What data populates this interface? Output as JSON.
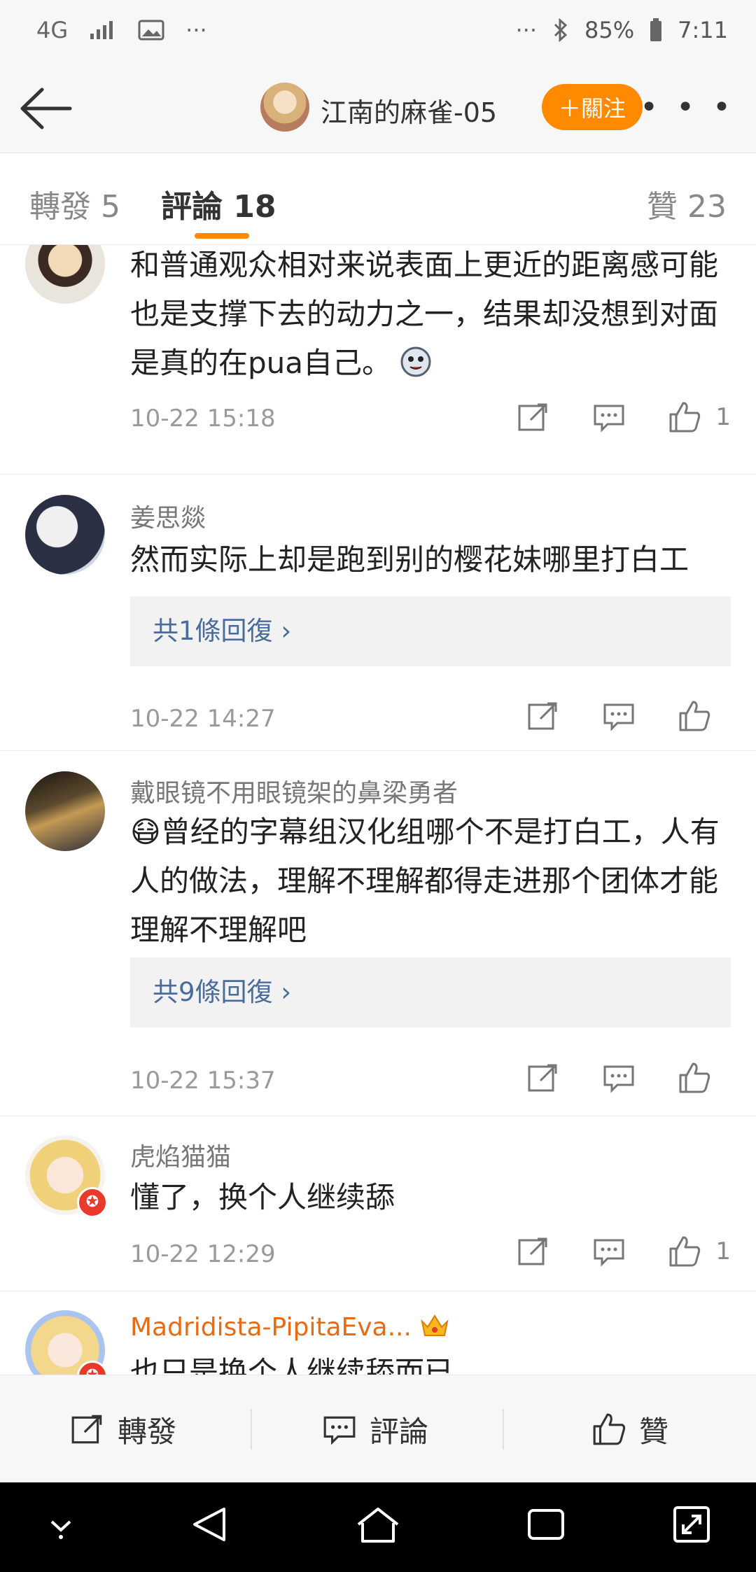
{
  "status_bar": {
    "network": "4G",
    "dots_left": "···",
    "dots_right": "···",
    "battery": "85%",
    "time": "7:11"
  },
  "nav": {
    "title": "江南的麻雀-05",
    "follow_label": "＋關注",
    "more_label": "• • •"
  },
  "tabs": [
    {
      "label": "轉發 5"
    },
    {
      "label": "評論 18"
    },
    {
      "label": "贊 23"
    }
  ],
  "comments": [
    {
      "username": "",
      "text": "和普通观众相对来说表面上更近的距离感可能也是支撑下去的动力之一，结果却没想到对面是真的在pua自己。",
      "time": "10-22 15:18",
      "likes": "1"
    },
    {
      "username": "姜思燚",
      "text": "然而实际上却是跑到别的樱花妹哪里打白工",
      "reply_label": "共1條回復",
      "time": "10-22 14:27",
      "likes": ""
    },
    {
      "username": "戴眼镜不用眼镜架的鼻梁勇者",
      "text": "😷曾经的字幕组汉化组哪个不是打白工，人有人的做法，理解不理解都得走进那个团体才能理解不理解吧",
      "reply_label": "共9條回復",
      "time": "10-22 15:37",
      "likes": ""
    },
    {
      "username": "虎焰猫猫",
      "text": "懂了，换个人继续舔",
      "time": "10-22 12:29",
      "likes": "1"
    },
    {
      "username": "Madridista-PipitaEva...",
      "text": "也只是换个人继续舔而已",
      "time": "",
      "likes": ""
    }
  ],
  "bottom_bar": {
    "repost": "轉發",
    "comment": "評論",
    "like": "贊"
  },
  "colors": {
    "accent": "#ff8a00",
    "link": "#4a6c9a",
    "vip_badge": "#e8392a"
  }
}
